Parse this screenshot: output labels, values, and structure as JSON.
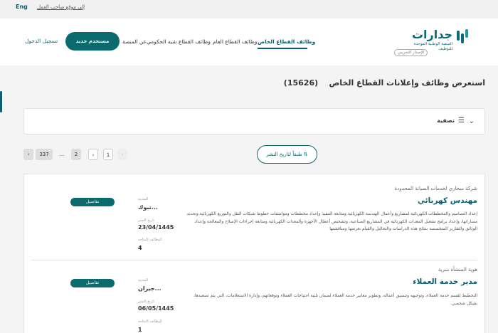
{
  "topbar": {
    "lang": "Eng",
    "employer_link": "إلى موقع صاحب العمل"
  },
  "logo": {
    "name": "جدارات",
    "subtitle": "المنصة الوطنية الموحدة للتوظيف",
    "beta": "الإصدار التجريبي"
  },
  "nav": {
    "items": [
      {
        "label": "وظائف القطاع الخاص",
        "active": true
      },
      {
        "label": "وظائف القطاع العام"
      },
      {
        "label": "وظائف القطاع شبه الحكومي"
      },
      {
        "label": "عن المنصة"
      }
    ],
    "new_user": "مستخدم جديد",
    "login": "تسجيل الدخول"
  },
  "page": {
    "title": "استعرض وظائف وإعلانات القطاع الخاص",
    "count": "(15626)"
  },
  "filter": {
    "label": "تصفية"
  },
  "sort": {
    "label": "طبقاً لتاريخ النشر"
  },
  "pagination": {
    "pages": [
      "1",
      "2",
      "...",
      "337"
    ]
  },
  "jobs": [
    {
      "company": "شركة سحاري لخدمات الصيانة المحدودة",
      "title": "مهندس كهربائي",
      "desc_lines": [
        "إعداد التصاميم والمخططات الكهربائية لمشاريع وأعمال الهندسة الكهربائية ومتابعة التنفيذ وإعداد مخططات ومواصفات خطوط شبكات النقل والتوزيع الكهربائية وتحديد",
        "مساراتها، وإعداد برامج تشغيل المعدات الكهربائية في المشاريع الصناعية، وتشخيص أعطال الأجهزة والمعدات الكهربائية ومتابعة إجراءات الإصلاح والمعالجة وإعداد",
        "الوثائق والتقارير المتخصصة بنتائج هذه الدراسات والتحاليل والقيام بعرضها ومناقشتها"
      ],
      "city_label": "المدينة",
      "city": "تبوك...",
      "date_label": "تاريخ النشر",
      "date": "23/04/1445",
      "vacancies_label": "الوظائف المتاحة",
      "vacancies": "4",
      "details": "تفاصيل"
    },
    {
      "company": "هوية المنشأة سرية",
      "title": "مدير خدمة العملاء",
      "desc_lines": [
        "التخطيط لقسم خدمة العملاء، وتوجيهه وتنسيق أعماله، وتطوير معايير خدمة العملاء لضمان تلبية احتياجات العملاء وتوقعاتهم، وإدارة الاستعلامات، التي يتم تصعيدها،",
        "بشكل شخصي."
      ],
      "city_label": "المدينة",
      "city": "جيزان...",
      "date_label": "تاريخ النشر",
      "date": "06/05/1445",
      "vacancies_label": "الوظائف المتاحة",
      "vacancies": "1",
      "details": "تفاصيل"
    }
  ]
}
